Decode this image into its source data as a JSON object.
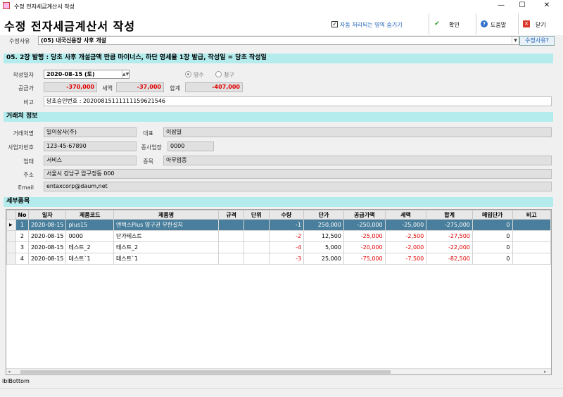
{
  "window": {
    "title": "수정 전자세금계산서 작성",
    "min": "—",
    "max": "☐",
    "close": "✕"
  },
  "header": {
    "title": "수정 전자세금계산서 작성",
    "auto_hide_label": "자동 처리되는 영역 숨기기",
    "auto_hide_checked": "✓",
    "confirm_label": "확인",
    "help_label": "도움말",
    "close_label": "닫기"
  },
  "reason": {
    "label": "수정사유",
    "value": "(05) 내국신용장 사후 개설",
    "button": "수정사유?"
  },
  "section1": {
    "title": "05. 2장 발행 : 당초 사후 개설금액 만큼 마이너스, 하단 영세율 1장 발급, 작성일 = 당초 작성일",
    "date_label": "작성일자",
    "date_value": "2020-08-15 (토)",
    "radio_receipt": "영수",
    "radio_claim": "청구",
    "supply_label": "공급가",
    "supply_value": "-370,000",
    "tax_label": "세액",
    "tax_value": "-37,000",
    "total_label": "합계",
    "total_value": "-407,000",
    "memo_label": "비고",
    "memo_value": "당초승인번호 : 20200815111111159621546"
  },
  "partner": {
    "title": "거래처 정보",
    "name_label": "거래처명",
    "name_value": "일이삼사(주)",
    "ceo_label": "대표",
    "ceo_value": "이삼일",
    "bizno_label": "사업자번호",
    "bizno_value": "123-45-67890",
    "branch_label": "종사업장",
    "branch_value": "0000",
    "biztype_label": "업태",
    "biztype_value": "서비스",
    "bizitem_label": "종목",
    "bizitem_value": "아무업종",
    "addr_label": "주소",
    "addr_value": "서울시 강남구 압구정동 000",
    "email_label": "Email",
    "email_value": "entaxcorp@daum,net"
  },
  "items": {
    "title": "세부품목",
    "columns": [
      "No",
      "일자",
      "제품코드",
      "제품명",
      "규격",
      "단위",
      "수량",
      "단가",
      "공급가액",
      "세액",
      "합계",
      "매입단가",
      "비고"
    ],
    "rows": [
      [
        "1",
        "2020-08-15",
        "plus15",
        "엔택스Plus 영구권 무한설치",
        "",
        "",
        "-1",
        "250,000",
        "-250,000",
        "-25,000",
        "-275,000",
        "0",
        ""
      ],
      [
        "2",
        "2020-08-15",
        "0000",
        "단가테스트",
        "",
        "",
        "-2",
        "12,500",
        "-25,000",
        "-2,500",
        "-27,500",
        "0",
        ""
      ],
      [
        "3",
        "2020-08-15",
        "테스트_2",
        "테스트_2",
        "",
        "",
        "-4",
        "5,000",
        "-20,000",
        "-2,000",
        "-22,000",
        "0",
        ""
      ],
      [
        "4",
        "2020-08-15",
        "테스트`1",
        "테스트`1",
        "",
        "",
        "-3",
        "25,000",
        "-75,000",
        "-7,500",
        "-82,500",
        "0",
        ""
      ]
    ]
  },
  "status": {
    "text": "lblBottom"
  },
  "colors": {
    "section": "#b4ecee",
    "selected": "#497f9c",
    "negative": "#e00000"
  }
}
